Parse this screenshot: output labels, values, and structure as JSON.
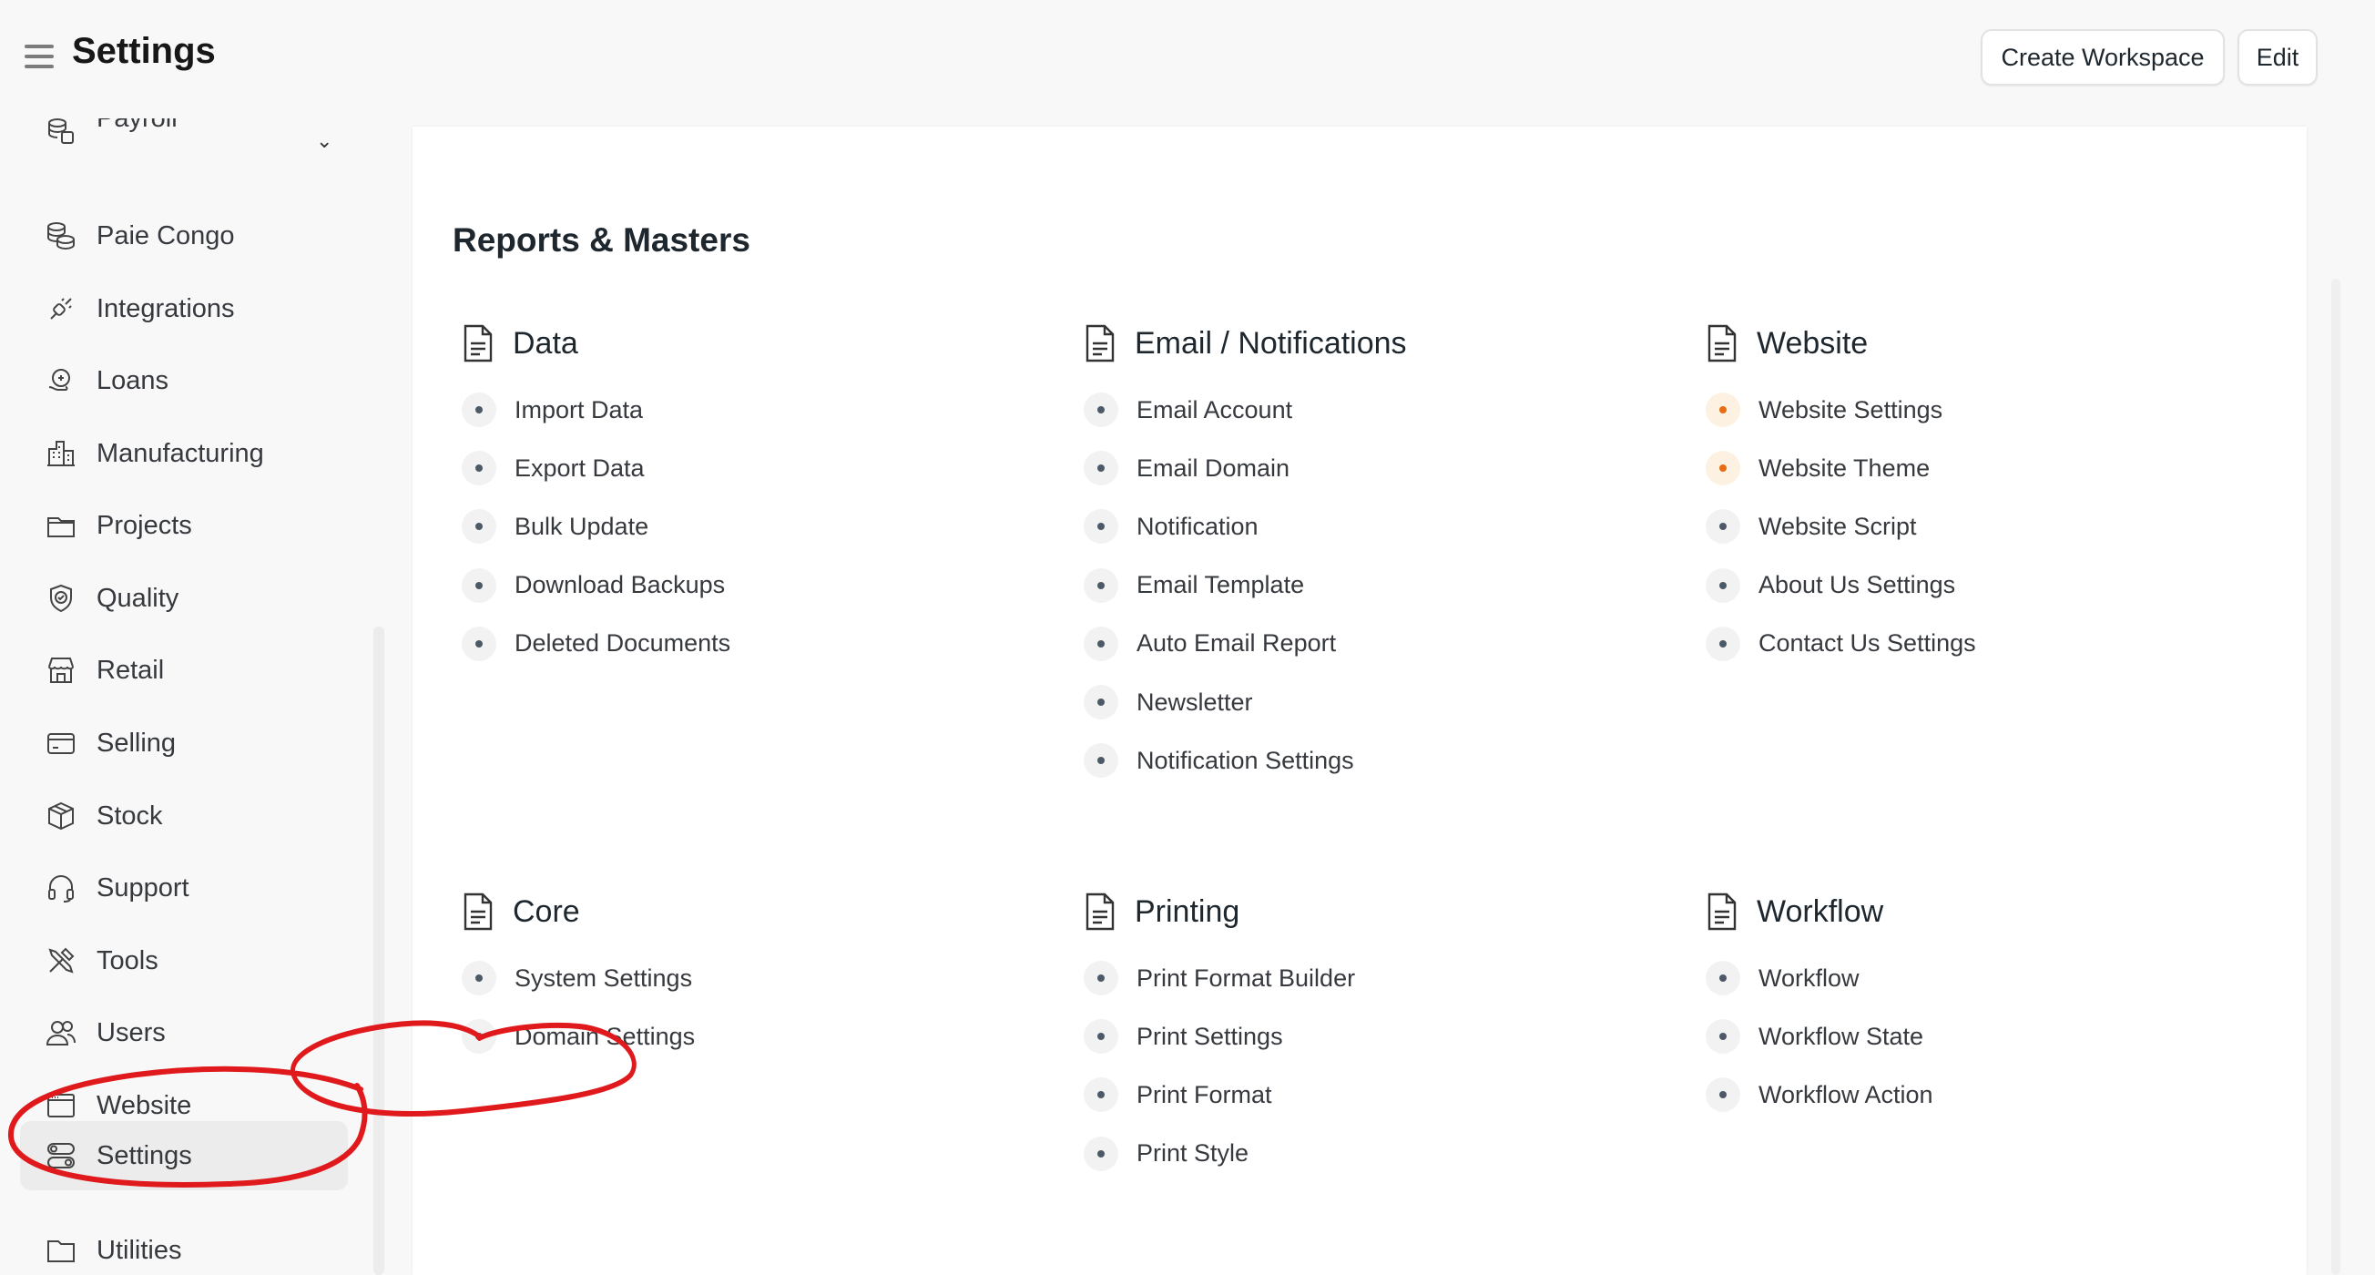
{
  "header": {
    "title": "Settings",
    "create_workspace": "Create Workspace",
    "edit": "Edit"
  },
  "sidebar": {
    "items": [
      {
        "label": "Payroll",
        "icon": "money-stack-icon"
      },
      {
        "label": "Paie Congo",
        "icon": "coins-icon"
      },
      {
        "label": "Integrations",
        "icon": "plug-icon"
      },
      {
        "label": "Loans",
        "icon": "hand-coin-icon"
      },
      {
        "label": "Manufacturing",
        "icon": "factory-icon"
      },
      {
        "label": "Projects",
        "icon": "folder-icon"
      },
      {
        "label": "Quality",
        "icon": "quality-badge-icon"
      },
      {
        "label": "Retail",
        "icon": "store-icon"
      },
      {
        "label": "Selling",
        "icon": "card-icon"
      },
      {
        "label": "Stock",
        "icon": "box-icon"
      },
      {
        "label": "Support",
        "icon": "headset-icon"
      },
      {
        "label": "Tools",
        "icon": "tools-icon"
      },
      {
        "label": "Users",
        "icon": "users-icon"
      },
      {
        "label": "Website",
        "icon": "browser-window-icon"
      },
      {
        "label": "Settings",
        "icon": "toggle-settings-icon",
        "active": true
      },
      {
        "label": "Utilities",
        "icon": "folder-icon"
      }
    ]
  },
  "main": {
    "section_title": "Reports & Masters",
    "groups": [
      {
        "title": "Data",
        "links": [
          "Import Data",
          "Export Data",
          "Bulk Update",
          "Download Backups",
          "Deleted Documents"
        ]
      },
      {
        "title": "Email / Notifications",
        "links": [
          "Email Account",
          "Email Domain",
          "Notification",
          "Email Template",
          "Auto Email Report",
          "Newsletter",
          "Notification Settings"
        ]
      },
      {
        "title": "Website",
        "links": [
          "Website Settings",
          "Website Theme",
          "Website Script",
          "About Us Settings",
          "Contact Us Settings"
        ]
      },
      {
        "title": "Core",
        "links": [
          "System Settings",
          "Domain Settings"
        ]
      },
      {
        "title": "Printing",
        "links": [
          "Print Format Builder",
          "Print Settings",
          "Print Format",
          "Print Style"
        ]
      },
      {
        "title": "Workflow",
        "links": [
          "Workflow",
          "Workflow State",
          "Workflow Action"
        ]
      }
    ]
  },
  "colors": {
    "annotation_red": "#e0191d",
    "orange_dot": "#e86c13",
    "sidebar_active_bg": "#ececec"
  }
}
